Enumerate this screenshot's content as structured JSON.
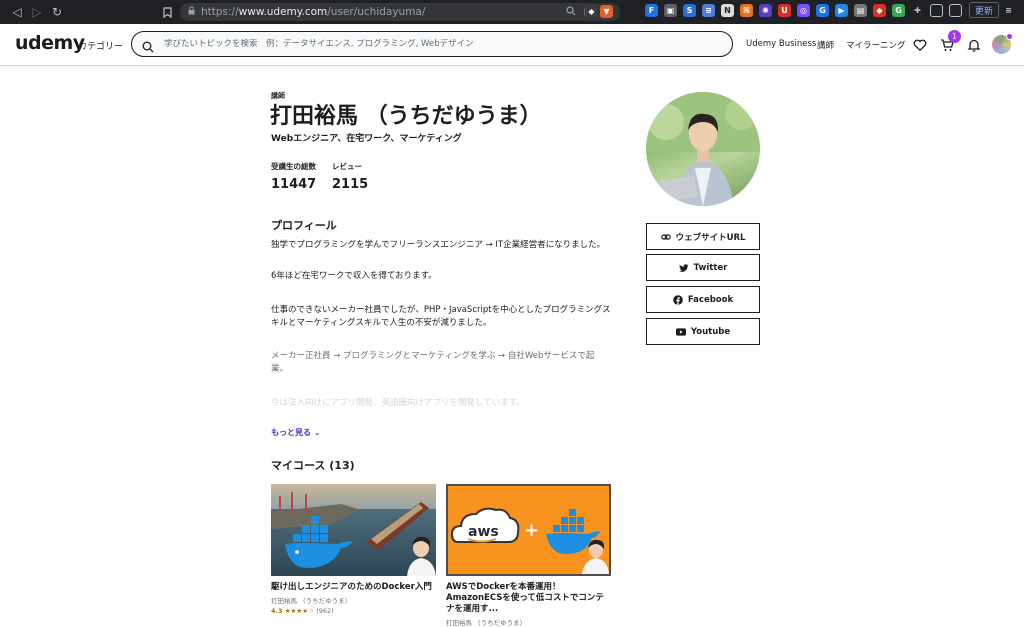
{
  "browser": {
    "url_prefix": "https://",
    "url_host": "www.udemy.com",
    "url_path": "/user/uchidayuma/",
    "update_label": "更新"
  },
  "header": {
    "logo": "udemy",
    "categories": "カテゴリー",
    "search_placeholder": "学びたいトピックを検索　例：データサイエンス, プログラミング, Webデザイン",
    "business": "Udemy Business",
    "instructor": "講師",
    "my_learning": "マイラーニング",
    "cart_count": "1"
  },
  "profile": {
    "role": "講師",
    "name": "打田裕馬 （うちだゆうま）",
    "headline": "Webエンジニア、在宅ワーク、マーケティング",
    "stats": [
      {
        "label": "受講生の総数",
        "value": "11447"
      },
      {
        "label": "レビュー",
        "value": "2115"
      }
    ],
    "about_title": "プロフィール",
    "bio": [
      "独学でプログラミングを学んでフリーランスエンジニア → IT企業経営者になりました。",
      "6年ほど在宅ワークで収入を得ております。",
      "仕事のできないメーカー社員でしたが、PHP・JavaScriptを中心としたプログラミングスキルとマーケティングスキルで人生の不安が減りました。",
      "メーカー正社員 → プログラミングとマーケティングを学ぶ → 自社Webサービスで起業。",
      "今は法人向けにアプリ開発、英語圏向けアプリを開発しています。"
    ],
    "show_more": "もっと見る ⌄"
  },
  "links": [
    {
      "label": "ウェブサイトURL",
      "icon": "link-icon"
    },
    {
      "label": "Twitter",
      "icon": "twitter-icon"
    },
    {
      "label": "Facebook",
      "icon": "facebook-icon"
    },
    {
      "label": "Youtube",
      "icon": "youtube-icon"
    }
  ],
  "courses_title": "マイコース (13)",
  "courses": [
    {
      "title": "駆け出しエンジニアのためのDocker入門",
      "author": "打田裕馬 （うちだゆうま）",
      "rating": "4.3 ★★★★☆",
      "reviews": "(962)"
    },
    {
      "title": "AWSでDockerを本番運用！AmazonECSを使って低コストでコンテナを運用す...",
      "author": "打田裕馬 （うちだゆうま）",
      "aws_logo": "aws"
    }
  ],
  "colors": {
    "brand_purple": "#a435f0",
    "link_purple": "#5624d0",
    "aws_orange": "#f7931e",
    "docker_blue": "#1d8fe0"
  }
}
